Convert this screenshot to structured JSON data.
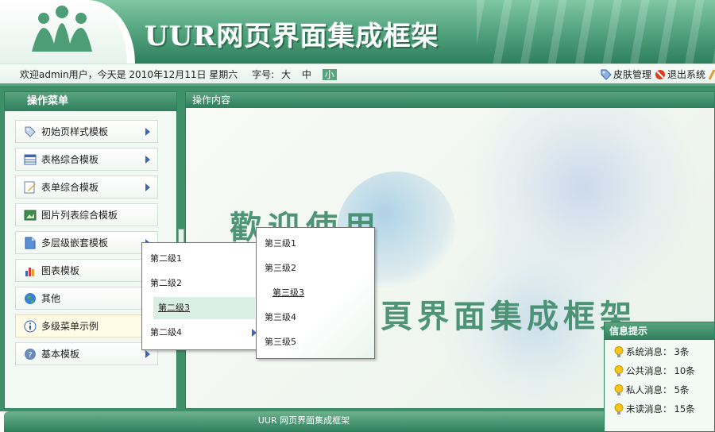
{
  "header": {
    "title": "UUR网页界面集成框架"
  },
  "infobar": {
    "welcome": "欢迎admin用户，今天是 2010年12月11日 星期六",
    "font_size_label": "字号:",
    "font_sizes": [
      "大",
      "中",
      "小"
    ],
    "skin_link": "皮肤管理",
    "logout_link": "退出系统"
  },
  "left_panel": {
    "title": "操作菜单",
    "items": [
      {
        "label": "初始页样式模板",
        "icon": "tag-icon",
        "has_arrow": true
      },
      {
        "label": "表格综合模板",
        "icon": "table-icon",
        "has_arrow": true
      },
      {
        "label": "表单综合模板",
        "icon": "form-edit-icon",
        "has_arrow": true
      },
      {
        "label": "图片列表综合模板",
        "icon": "image-icon",
        "has_arrow": false
      },
      {
        "label": "多层级嵌套模板",
        "icon": "document-icon",
        "has_arrow": true
      },
      {
        "label": "图表模板",
        "icon": "bar-chart-icon",
        "has_arrow": false
      },
      {
        "label": "其他",
        "icon": "globe-icon",
        "has_arrow": false
      },
      {
        "label": "多级菜单示例",
        "icon": "info-icon",
        "has_arrow": false
      },
      {
        "label": "基本模板",
        "icon": "help-icon",
        "has_arrow": true
      }
    ]
  },
  "right_panel": {
    "title": "操作内容",
    "welcome_line1": "歡迎使用",
    "welcome_line2": "頁界面集成框架"
  },
  "submenu_level2": [
    "第二级1",
    "第二级2",
    "第二级3",
    "第二级4"
  ],
  "submenu_level3": [
    "第三级1",
    "第三级2",
    "第三级3",
    "第三级4",
    "第三级5"
  ],
  "info_tip": {
    "title": "信息提示",
    "rows": [
      {
        "label": "系统消息：",
        "value": "3条"
      },
      {
        "label": "公共消息：",
        "value": "10条"
      },
      {
        "label": "私人消息：",
        "value": "5条"
      },
      {
        "label": "未读消息：",
        "value": "15条"
      }
    ]
  },
  "footer": {
    "text": "UUR 网页界面集成框架"
  },
  "colors": {
    "primary_green": "#2e7f5c",
    "light_green": "#5aa37f",
    "link_blue": "#3a67b8"
  }
}
